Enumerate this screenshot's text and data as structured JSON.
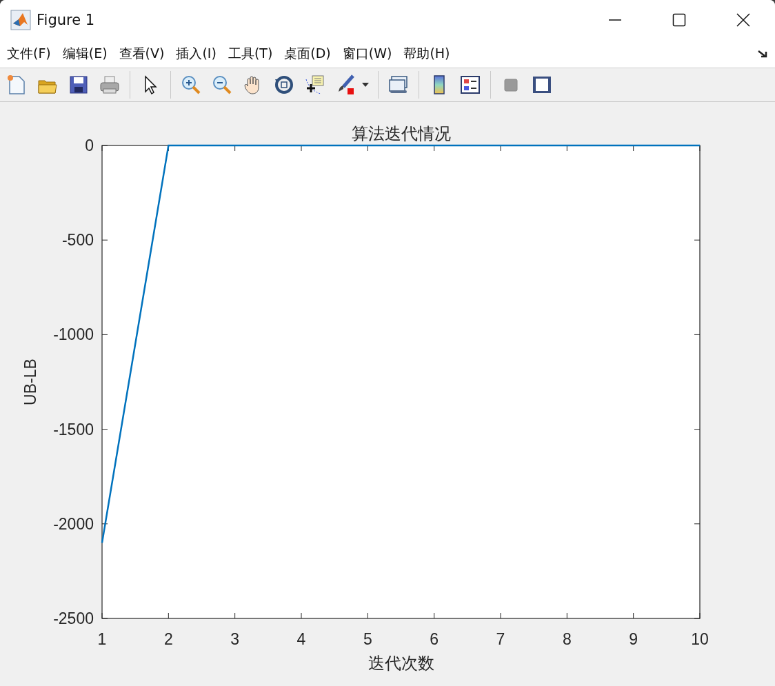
{
  "window": {
    "title": "Figure 1"
  },
  "menu": [
    {
      "label": "文件(F)"
    },
    {
      "label": "编辑(E)"
    },
    {
      "label": "查看(V)"
    },
    {
      "label": "插入(I)"
    },
    {
      "label": "工具(T)"
    },
    {
      "label": "桌面(D)"
    },
    {
      "label": "窗口(W)"
    },
    {
      "label": "帮助(H)"
    }
  ],
  "figure": {
    "chart_data": {
      "type": "line",
      "title": "算法迭代情况",
      "xlabel": "迭代次数",
      "ylabel": "UB-LB",
      "x": [
        1,
        2,
        3,
        4,
        5,
        6,
        7,
        8,
        9,
        10
      ],
      "series": [
        {
          "color": "#0072bd",
          "values": [
            -2100,
            0,
            0,
            0,
            0,
            0,
            0,
            0,
            0,
            0
          ]
        }
      ],
      "xlim": [
        1,
        10
      ],
      "ylim": [
        -2500,
        0
      ],
      "xticks": [
        1,
        2,
        3,
        4,
        5,
        6,
        7,
        8,
        9,
        10
      ],
      "yticks": [
        -2500,
        -2000,
        -1500,
        -1000,
        -500,
        0
      ]
    }
  }
}
